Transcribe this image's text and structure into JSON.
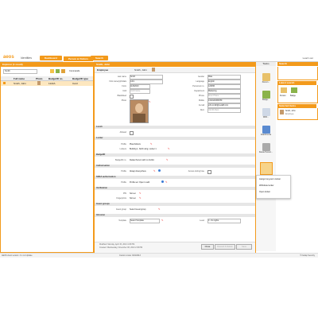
{
  "app": {
    "logo": "aeos",
    "app_name": "Identities",
    "tabs": [
      "Dashboard",
      "Person & Visitors",
      "Search"
    ],
    "user": "Lead  Lout"
  },
  "left": {
    "title": "Explorer (1 result)",
    "search_value": "Smith",
    "columns": [
      "Full name",
      "Photo",
      "Badge/ID no.",
      "Badge/ID type"
    ],
    "rows": [
      {
        "name": "Smith, John",
        "badge": "1122A",
        "type": "Card"
      }
    ],
    "toolbar_label": "Commands"
  },
  "main": {
    "title": "Smith, John",
    "header_label": "Employee",
    "header_name": "Smith, John",
    "fields_left": [
      {
        "label": "Last name",
        "value": "Smith"
      },
      {
        "label": "First name(s)/Initials",
        "value": "John"
      },
      {
        "label": "From",
        "value": "11/8/2013"
      },
      {
        "label": "Until",
        "value": "Until Future"
      },
      {
        "label": "Blacklisted",
        "value": ""
      },
      {
        "label": "Photo",
        "value": ""
      }
    ],
    "fields_right": [
      {
        "label": "Gender",
        "value": "Male"
      },
      {
        "label": "Language",
        "value": "English"
      },
      {
        "label": "Personnel no.",
        "value": "123456"
      },
      {
        "label": "Department",
        "value": "Marketing"
      },
      {
        "label": "Phone",
        "value": "Enter Phone"
      },
      {
        "label": "Mobile",
        "value": "1310123456789"
      },
      {
        "label": "E-mail",
        "value": "john.smith@nedaP.com"
      },
      {
        "label": "Rem",
        "value": "Unit #1 Rem"
      }
    ],
    "sections": [
      {
        "title": "Lunch",
        "rows": [
          {
            "label": "Allowed",
            "value": ""
          }
        ]
      },
      {
        "title": "Locker",
        "rows": [
          {
            "label": "Profile",
            "value": "Placeholders"
          },
          {
            "label": "Lockers",
            "value": "Building 1, North wing, Locker 1"
          }
        ]
      },
      {
        "title": "Badge/ID",
        "rows": [
          {
            "label": "Badge/ID no.",
            "value": "Relate Person with no 1122A"
          }
        ]
      },
      {
        "title": "Authorisation",
        "rows": [
          {
            "label": "Profile",
            "value": "Always Everywhere"
          },
          {
            "label": "Access during fuse",
            "value": ""
          }
        ]
      },
      {
        "title": "SDKA authorisation",
        "rows": [
          {
            "label": "Profile",
            "value": "Profile set: Open to add"
          }
        ]
      },
      {
        "title": "Verification",
        "rows": [
          {
            "label": "PIN",
            "value": "Not set"
          },
          {
            "label": "Fingerprints",
            "value": "Not set"
          }
        ]
      },
      {
        "title": "Guest groups",
        "rows": [
          {
            "label": "Guest group",
            "value": "Select Guest group"
          }
        ]
      },
      {
        "title": "Intrusion",
        "rows": [
          {
            "label": "Template",
            "value": "Select Template"
          },
          {
            "label": "Level",
            "value": "0 - No rights"
          }
        ]
      }
    ],
    "footer": {
      "modified": "Modified: Monday, April 15, 2013 4:45 PM",
      "created": "Created: Wednesday, November 06, 2013 2:45 PM",
      "close": "Close",
      "discard": "Discard & Delete",
      "save": "Save"
    }
  },
  "tools": {
    "title": "Tasks",
    "items": [
      "Person...",
      "Badge...",
      "WPA...",
      "Attachments",
      "Delete Person..."
    ]
  },
  "menu": {
    "items": [
      "Assign long-term locker",
      "Withdraw locker",
      "Open locker"
    ]
  },
  "right": {
    "search_title": "Search",
    "recent_title": "Latest search",
    "recent_items": [
      "Person",
      "Badge"
    ],
    "selected_title": "Selected items",
    "selected_name": "Smith, John",
    "selected_sub": "Employee"
  },
  "status": {
    "left": "AEOS client version: 3.1.1 & Update",
    "center": "Custom mode: 9/04/2013",
    "right": "© Nedap Security"
  }
}
